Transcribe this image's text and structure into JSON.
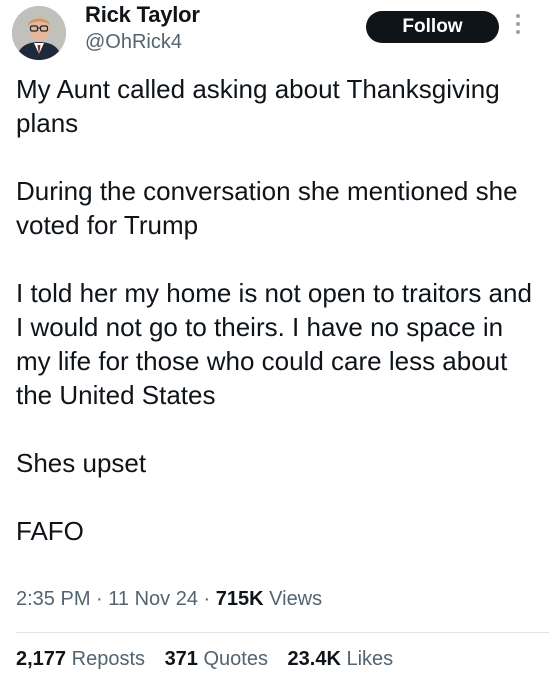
{
  "user": {
    "name": "Rick Taylor",
    "handle": "@OhRick4",
    "avatar": "profile-photo"
  },
  "follow_button": {
    "label": "Follow"
  },
  "more_icon": "vertical-ellipsis-icon",
  "tweet": {
    "paragraphs": [
      "My Aunt called asking about Thanksgiving plans",
      "During the conversation she mentioned she voted for Trump",
      "I told her my home is not open to traitors and I would not go to theirs. I have no space in my life for those who could care less about the United States",
      "Shes upset",
      "FAFO"
    ]
  },
  "meta": {
    "time": "2:35 PM",
    "date": "11 Nov 24",
    "views_count": "715K",
    "views_label": "Views",
    "separator": "·"
  },
  "stats": {
    "reposts_count": "2,177",
    "reposts_label": "Reposts",
    "quotes_count": "371",
    "quotes_label": "Quotes",
    "likes_count": "23.4K",
    "likes_label": "Likes"
  },
  "colors": {
    "text": "#0f1419",
    "secondary": "#536471",
    "button_bg": "#0f1419",
    "divider": "#dde3e8"
  }
}
